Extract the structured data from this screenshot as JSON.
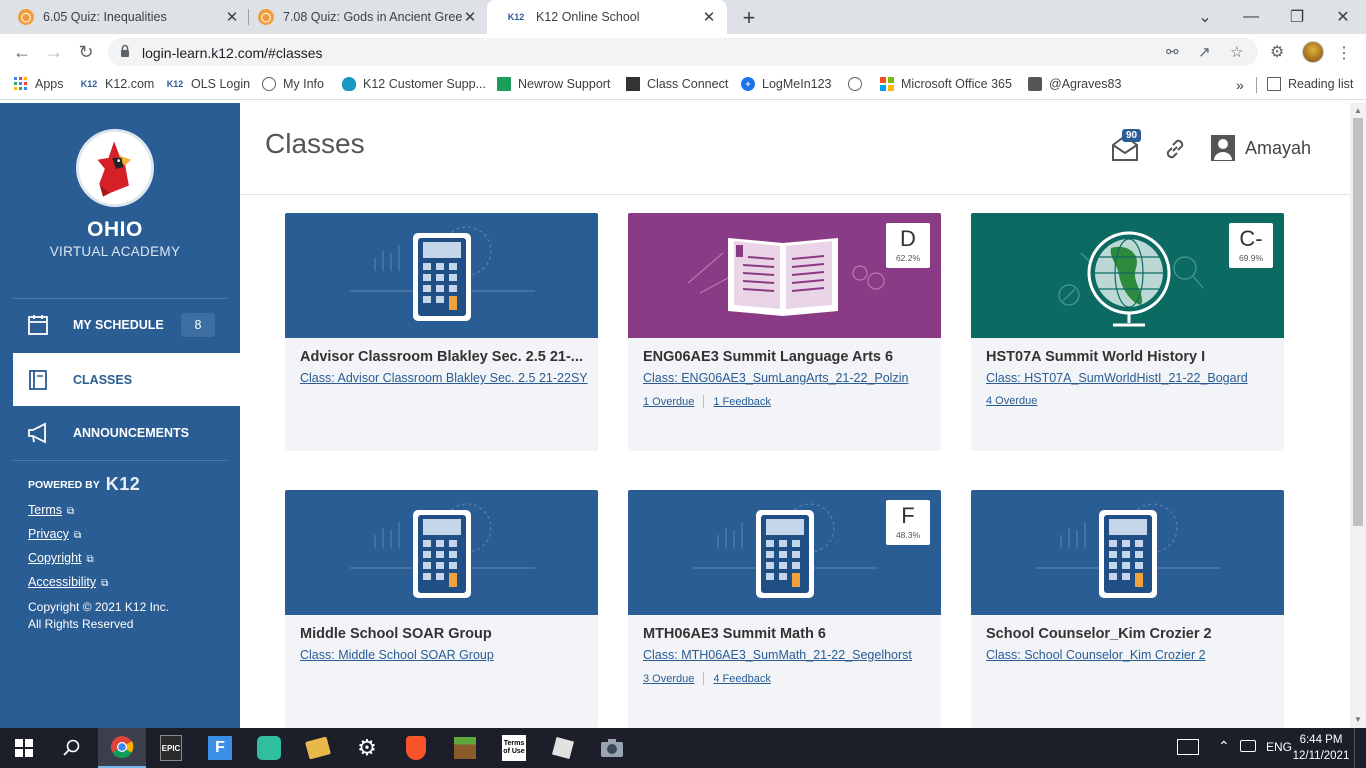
{
  "browser": {
    "tabs": [
      {
        "title": "6.05 Quiz: Inequalities",
        "favicon": "quiz-favicon"
      },
      {
        "title": "7.08 Quiz: Gods in Ancient Greec",
        "favicon": "quiz-favicon"
      },
      {
        "title": "K12 Online School",
        "favicon": "k12-favicon",
        "favicon_text": "K12"
      }
    ],
    "url": "login-learn.k12.com/#classes",
    "bookmarks": [
      {
        "label": "Apps",
        "icon": "apps-grid-icon"
      },
      {
        "label": "K12.com",
        "icon": "k12-icon",
        "icon_text": "K12"
      },
      {
        "label": "OLS Login",
        "icon": "k12-icon",
        "icon_text": "K12"
      },
      {
        "label": "My Info",
        "icon": "globe-icon"
      },
      {
        "label": "K12 Customer Supp...",
        "icon": "salesforce-icon"
      },
      {
        "label": "Newrow Support",
        "icon": "newrow-icon"
      },
      {
        "label": "Class Connect",
        "icon": "class-connect-icon"
      },
      {
        "label": "LogMeIn123",
        "icon": "logmein-icon"
      },
      {
        "label": "",
        "icon": "globe-icon"
      },
      {
        "label": "Microsoft Office 365",
        "icon": "microsoft-icon"
      },
      {
        "label": "@Agraves83",
        "icon": "agraves-icon"
      }
    ],
    "reading_list": "Reading list",
    "more": "»"
  },
  "sidebar": {
    "school_name": "OHIO",
    "school_sub": "VIRTUAL ACADEMY",
    "nav": [
      {
        "label": "MY SCHEDULE",
        "badge": "8",
        "icon": "calendar-icon"
      },
      {
        "label": "CLASSES",
        "icon": "book-icon"
      },
      {
        "label": "ANNOUNCEMENTS",
        "icon": "megaphone-icon"
      }
    ],
    "powered_by": "POWERED BY",
    "powered_brand": "K12",
    "links": [
      "Terms",
      "Privacy",
      "Copyright",
      "Accessibility"
    ],
    "copyright_line1": "Copyright © 2021 K12 Inc.",
    "copyright_line2": "All Rights Reserved"
  },
  "header": {
    "title": "Classes",
    "mail_count": "90",
    "user_name": "Amayah"
  },
  "classes": [
    {
      "title": "Advisor Classroom Blakley Sec. 2.5 21-...",
      "subtitle": "Class: Advisor Classroom Blakley Sec. 2.5 21-22SY",
      "banner": "calculator",
      "color": "#2a5d94"
    },
    {
      "title": "ENG06AE3 Summit Language Arts 6",
      "subtitle": "Class: ENG06AE3_SumLangArts_21-22_Polzin",
      "banner": "book",
      "color": "#8a3b86",
      "grade": "D",
      "percent": "62.2%",
      "meta": [
        "1 Overdue",
        "1 Feedback"
      ]
    },
    {
      "title": "HST07A Summit World History I",
      "subtitle": "Class: HST07A_SumWorldHistI_21-22_Bogard",
      "banner": "globe",
      "color": "#0b6b63",
      "grade": "C-",
      "percent": "69.9%",
      "meta": [
        "4 Overdue"
      ]
    },
    {
      "title": "Middle School SOAR Group",
      "subtitle": "Class: Middle School SOAR Group",
      "banner": "calculator",
      "color": "#2a5d94"
    },
    {
      "title": "MTH06AE3 Summit Math 6",
      "subtitle": "Class: MTH06AE3_SumMath_21-22_Segelhorst",
      "banner": "calculator",
      "color": "#2a5d94",
      "grade": "F",
      "percent": "48.3%",
      "meta": [
        "3 Overdue",
        "4 Feedback"
      ]
    },
    {
      "title": "School Counselor_Kim Crozier 2",
      "subtitle": "Class: School Counselor_Kim Crozier 2",
      "banner": "calculator",
      "color": "#2a5d94"
    }
  ],
  "taskbar": {
    "lang": "ENG",
    "time": "6:44 PM",
    "date": "12/11/2021",
    "apps": [
      "windows-start-icon",
      "search-icon",
      "chrome-icon",
      "epic-games-icon",
      "fortnite-icon",
      "discord-icon",
      "folder-icon",
      "settings-gear-icon",
      "brave-icon",
      "minecraft-icon",
      "terms-of-use-icon",
      "roblox-icon",
      "camera-icon"
    ],
    "terms_text": "Terms of Use",
    "epic_text": "EPIC"
  }
}
